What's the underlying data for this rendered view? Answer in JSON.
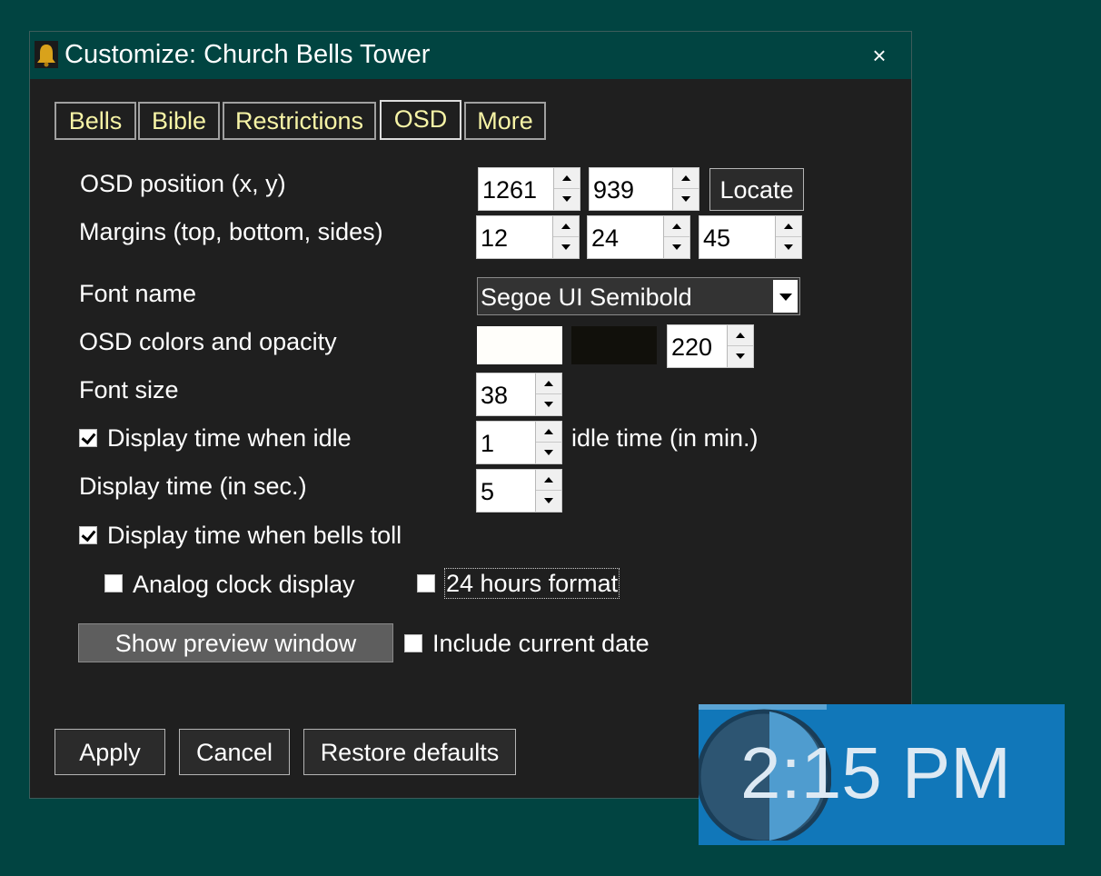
{
  "window": {
    "title": "Customize: Church Bells Tower",
    "close_glyph": "×"
  },
  "tabs": [
    {
      "label": "Bells"
    },
    {
      "label": "Bible"
    },
    {
      "label": "Restrictions"
    },
    {
      "label": "OSD",
      "selected": true
    },
    {
      "label": "More"
    }
  ],
  "osd": {
    "position_label": "OSD position (x, y)",
    "pos_x": "1261",
    "pos_y": "939",
    "locate_label": "Locate",
    "margins_label": "Margins (top, bottom, sides)",
    "margin_top": "12",
    "margin_bottom": "24",
    "margin_sides": "45",
    "font_name_label": "Font name",
    "font_name_value": "Segoe UI Semibold",
    "colors_label": "OSD colors and opacity",
    "text_color": "#fffefa",
    "bg_color": "#11100b",
    "opacity": "220",
    "font_size_label": "Font size",
    "font_size": "38",
    "idle_label": "Display time when idle",
    "idle_checked": true,
    "idle_minutes": "1",
    "idle_time_label": "idle time (in min.)",
    "display_secs_label": "Display time (in sec.)",
    "display_secs": "5",
    "toll_label": "Display time when bells toll",
    "toll_checked": true,
    "analog_label": "Analog clock display",
    "analog_checked": false,
    "format24_label": "24 hours format",
    "format24_checked": false,
    "preview_button": "Show preview window",
    "include_date_label": "Include current date",
    "include_date_checked": false
  },
  "footer": {
    "apply_label": "Apply",
    "cancel_label": "Cancel",
    "restore_label": "Restore defaults"
  },
  "preview": {
    "time_text": "2:15 PM",
    "bg_color": "#1177b9"
  },
  "icons": {
    "app": "bell-icon",
    "close": "close-icon",
    "spin_up": "arrow-up-icon",
    "spin_down": "arrow-down-icon",
    "dropdown": "chevron-down-icon"
  }
}
